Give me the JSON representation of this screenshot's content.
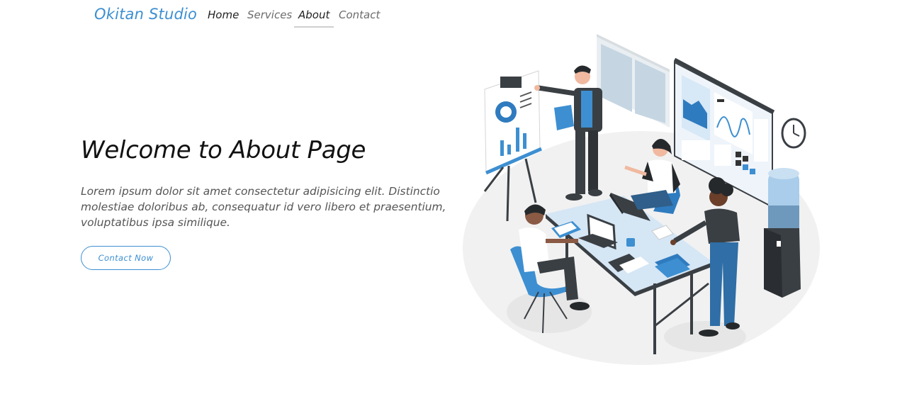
{
  "nav": {
    "brand": "Okitan Studio",
    "links": [
      {
        "label": "Home"
      },
      {
        "label": "Services"
      },
      {
        "label": "About"
      },
      {
        "label": "Contact"
      }
    ]
  },
  "hero": {
    "title": "Welcome to About Page",
    "text": "Lorem ipsum dolor sit amet consectetur adipisicing elit. Distinctio molestiae doloribus ab, consequatur id vero libero et praesentium, voluptatibus ipsa similique.",
    "cta_label": "Contact Now"
  },
  "colors": {
    "accent": "#3d8fd1",
    "text_dark": "#111111",
    "text_muted": "#555555"
  },
  "illustration": {
    "icon": "team-meeting-illustration"
  }
}
